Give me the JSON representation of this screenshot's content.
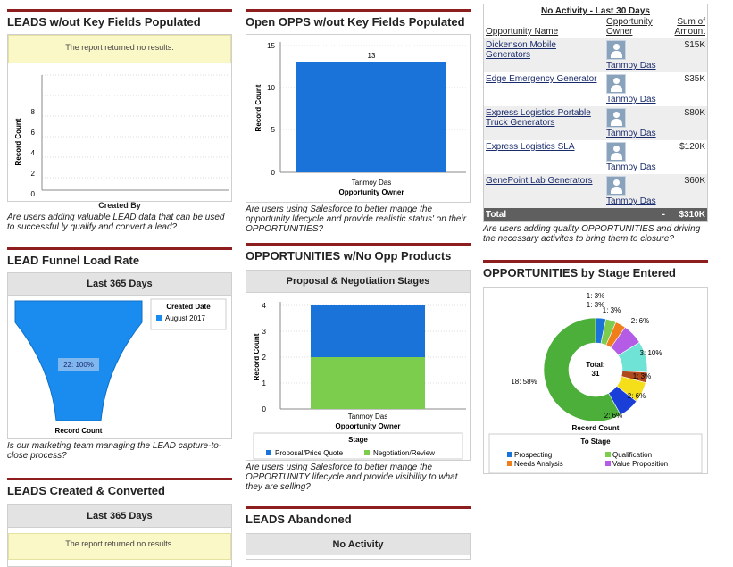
{
  "col1": {
    "leads_keyfields": {
      "title": "LEADS w/out Key Fields Populated",
      "no_results": "The report returned no results.",
      "y_label": "Record Count",
      "y_ticks": [
        "8",
        "6",
        "4",
        "2",
        "0"
      ],
      "x_label": "Created By",
      "caption": "Are users adding valuable LEAD data that can be used to successful ly qualify and convert a lead?"
    },
    "funnel": {
      "title": "LEAD Funnel Load Rate",
      "header": "Last 365 Days",
      "legend_title": "Created Date",
      "legend_item": "August 2017",
      "center_label": "22: 100%",
      "x_label": "Record Count",
      "caption": "Is our marketing team managing the LEAD capture-to-close process?",
      "color": "#1a8cf0"
    },
    "created_converted": {
      "title": "LEADS Created & Converted",
      "header": "Last 365 Days",
      "no_results": "The report returned no results."
    }
  },
  "col2": {
    "opps_keyfields": {
      "title": "Open OPPS w/out Key Fields Populated",
      "y_label": "Record Count",
      "y_ticks": [
        "15",
        "10",
        "5",
        "0"
      ],
      "bar_label": "13",
      "x_category": "Tanmoy Das",
      "x_label": "Opportunity Owner",
      "caption": "Are users using Salesforce to better mange the opportunity lifecycle and provide realistic status' on their OPPORTUNITIES?",
      "color": "#1a73d9"
    },
    "opp_products": {
      "title": "OPPORTUNITIES w/No Opp Products",
      "header": "Proposal & Negotiation Stages",
      "y_label": "Record Count",
      "y_ticks": [
        "4",
        "3",
        "2",
        "1",
        "0"
      ],
      "x_category": "Tanmoy Das",
      "x_label": "Opportunity Owner",
      "legend_title": "Stage",
      "legend_items": [
        {
          "label": "Proposal/Price Quote",
          "color": "#1a73d9"
        },
        {
          "label": "Negotiation/Review",
          "color": "#7ccc4e"
        }
      ],
      "caption": "Are users using Salesforce to better mange the OPPORTUNITY lifecycle and provide visibility to what they are selling?"
    },
    "abandoned": {
      "title": "LEADS Abandoned",
      "header": "No Activity"
    }
  },
  "col3": {
    "no_activity": {
      "title": "No Activity - Last 30 Days",
      "col_name": "Opportunity Name",
      "col_owner": "Opportunity Owner",
      "col_amount": "Sum of Amount",
      "rows": [
        {
          "name": "Dickenson Mobile Generators",
          "owner": "Tanmoy Das",
          "amount": "$15K"
        },
        {
          "name": "Edge Emergency Generator",
          "owner": "Tanmoy Das",
          "amount": "$35K"
        },
        {
          "name": "Express Logistics Portable Truck Generators",
          "owner": "Tanmoy Das",
          "amount": "$80K"
        },
        {
          "name": "Express Logistics SLA",
          "owner": "Tanmoy Das",
          "amount": "$120K"
        },
        {
          "name": "GenePoint Lab Generators",
          "owner": "Tanmoy Das",
          "amount": "$60K"
        }
      ],
      "total_label": "Total",
      "total_amount": "$310K",
      "caption": "Are users adding quality OPPORTUNITIES and driving the necessary activites to bring them to closure?"
    },
    "by_stage": {
      "title": "OPPORTUNITIES by Stage Entered",
      "center_label": "Total:",
      "center_value": "31",
      "x_label": "Record Count",
      "legend_title": "To Stage",
      "legend_items": [
        {
          "label": "Prospecting",
          "color": "#1a73d9"
        },
        {
          "label": "Qualification",
          "color": "#7ccc4e"
        },
        {
          "label": "Needs Analysis",
          "color": "#f07f1a"
        },
        {
          "label": "Value Proposition",
          "color": "#b45ce6"
        }
      ]
    }
  },
  "chart_data": [
    {
      "type": "bar",
      "title": "Open OPPS w/out Key Fields Populated",
      "categories": [
        "Tanmoy Das"
      ],
      "values": [
        13
      ],
      "xlabel": "Opportunity Owner",
      "ylabel": "Record Count",
      "ylim": [
        0,
        15
      ]
    },
    {
      "type": "bar",
      "title": "Proposal & Negotiation Stages",
      "categories": [
        "Tanmoy Das"
      ],
      "series": [
        {
          "name": "Negotiation/Review",
          "values": [
            2
          ]
        },
        {
          "name": "Proposal/Price Quote",
          "values": [
            2
          ]
        }
      ],
      "stacked": true,
      "xlabel": "Opportunity Owner",
      "ylabel": "Record Count",
      "ylim": [
        0,
        4
      ]
    },
    {
      "type": "pie",
      "donut": true,
      "legend_title": "To Stage",
      "total": 31,
      "slices": [
        {
          "label": "1: 3%",
          "value": 1,
          "color": "#1a73d9"
        },
        {
          "label": "1: 3%",
          "value": 1,
          "color": "#7ccc4e"
        },
        {
          "label": "1: 3%",
          "value": 1,
          "color": "#f07f1a"
        },
        {
          "label": "2: 6%",
          "value": 2,
          "color": "#b45ce6"
        },
        {
          "label": "3: 10%",
          "value": 3,
          "color": "#6fe3d6"
        },
        {
          "label": "1: 3%",
          "value": 1,
          "color": "#b04a1e"
        },
        {
          "label": "2: 6%",
          "value": 2,
          "color": "#f5de1a"
        },
        {
          "label": "2: 6%",
          "value": 2,
          "color": "#1a3fd9"
        },
        {
          "label": "18: 58%",
          "value": 18,
          "color": "#4caf3a"
        }
      ]
    }
  ]
}
